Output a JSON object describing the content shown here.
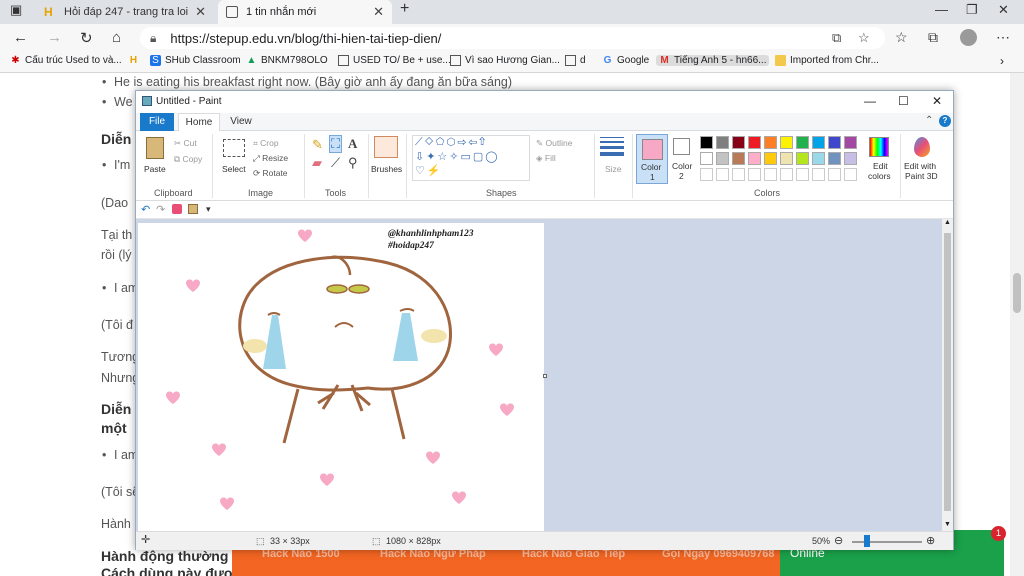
{
  "browser": {
    "tabs": [
      {
        "label": "Hỏi đáp 247 - trang tra loi",
        "active": false
      },
      {
        "label": "1 tin nhắn mới",
        "active": true
      }
    ],
    "url": "https://stepup.edu.vn/blog/thi-hien-tai-tiep-dien/",
    "bookmarks": [
      "Cấu trúc Used to và...",
      "SHub Classroom",
      "BNKM798OLO",
      "USED TO/ Be + use...",
      "Vì sao Hương Gian...",
      "d",
      "Google",
      "Tiếng Anh 5 - hn66...",
      "Imported from Chr..."
    ]
  },
  "webpage": {
    "lines": [
      "He is eating his breakfast right now. (Bây giờ anh ấy đang ăn bữa sáng)",
      "We",
      "Diễn",
      "I'm",
      "(Dao",
      "Tại th",
      "rồi (lý",
      "I am",
      "(Tôi đ",
      "Tương",
      "Nhưng",
      "Diễn",
      "một",
      "I am",
      "(Tôi sẽ",
      "Hành",
      "Hành động thường",
      "Cách dùng này được"
    ],
    "bottom_bar": [
      "Hack Não 1500",
      "Hack Não Ngữ Pháp",
      "Hack Não Giao Tiếp",
      "Gọi Ngay 0969409768"
    ],
    "online_label": "Online",
    "notification_count": "1"
  },
  "paint": {
    "title": "Untitled - Paint",
    "tabs": {
      "file": "File",
      "home": "Home",
      "view": "View"
    },
    "ribbon": {
      "paste": "Paste",
      "cut": "Cut",
      "copy": "Copy",
      "clipboard": "Clipboard",
      "select": "Select",
      "crop": "Crop",
      "resize": "Resize",
      "rotate": "Rotate",
      "image": "Image",
      "tools": "Tools",
      "brushes": "Brushes",
      "outline": "Outline",
      "fill": "Fill",
      "shapes": "Shapes",
      "size": "Size",
      "color1": "Color",
      "color1_num": "1",
      "color2": "Color",
      "color2_num": "2",
      "colors": "Colors",
      "edit_colors_1": "Edit",
      "edit_colors_2": "colors",
      "edit_3d_1": "Edit with",
      "edit_3d_2": "Paint 3D"
    },
    "palette": [
      "#000000",
      "#7f7f7f",
      "#880015",
      "#ed1c24",
      "#ff7f27",
      "#fff200",
      "#22b14c",
      "#00a2e8",
      "#3f48cc",
      "#a349a4",
      "#ffffff",
      "#c3c3c3",
      "#b97a57",
      "#ffaec9",
      "#ffc90e",
      "#efe4b0",
      "#b5e61d",
      "#99d9ea",
      "#7092be",
      "#c8bfe7"
    ],
    "color1_value": "#f7a8c4",
    "color2_value": "#ffffff",
    "canvas": {
      "signature_line1": "@khanhlinhpham123",
      "signature_line2": "#hoidap247"
    },
    "status": {
      "selection_size": "33 × 33px",
      "image_size": "1080 × 828px",
      "zoom": "50%"
    }
  }
}
